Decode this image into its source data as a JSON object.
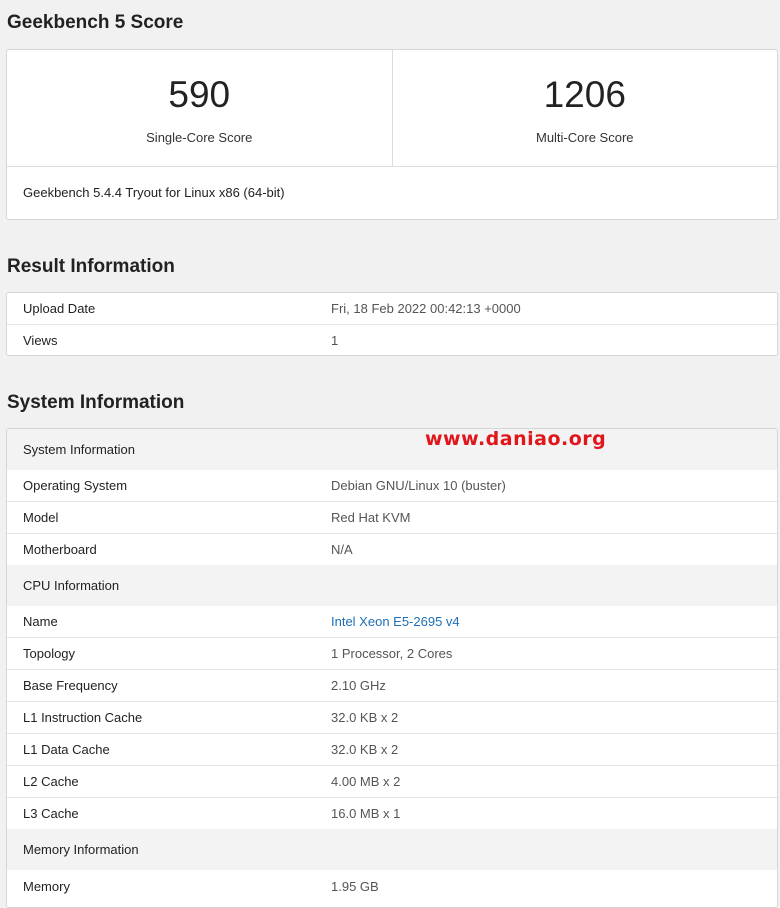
{
  "score_section": {
    "title": "Geekbench 5 Score",
    "single_core": {
      "value": "590",
      "label": "Single-Core Score"
    },
    "multi_core": {
      "value": "1206",
      "label": "Multi-Core Score"
    },
    "version": "Geekbench 5.4.4 Tryout for Linux x86 (64-bit)"
  },
  "result_section": {
    "title": "Result Information",
    "rows": [
      {
        "key": "Upload Date",
        "value": "Fri, 18 Feb 2022 00:42:13 +0000"
      },
      {
        "key": "Views",
        "value": "1"
      }
    ]
  },
  "system_section": {
    "title": "System Information",
    "groups": [
      {
        "header": "System Information",
        "rows": [
          {
            "key": "Operating System",
            "value": "Debian GNU/Linux 10 (buster)"
          },
          {
            "key": "Model",
            "value": "Red Hat KVM"
          },
          {
            "key": "Motherboard",
            "value": "N/A"
          }
        ]
      },
      {
        "header": "CPU Information",
        "rows": [
          {
            "key": "Name",
            "value": "Intel Xeon E5-2695 v4"
          },
          {
            "key": "Topology",
            "value": "1 Processor, 2 Cores"
          },
          {
            "key": "Base Frequency",
            "value": "2.10 GHz"
          },
          {
            "key": "L1 Instruction Cache",
            "value": "32.0 KB x 2"
          },
          {
            "key": "L1 Data Cache",
            "value": "32.0 KB x 2"
          },
          {
            "key": "L2 Cache",
            "value": "4.00 MB x 2"
          },
          {
            "key": "L3 Cache",
            "value": "16.0 MB x 1"
          }
        ]
      },
      {
        "header": "Memory Information",
        "rows": [
          {
            "key": "Memory",
            "value": "1.95 GB"
          }
        ]
      }
    ]
  },
  "watermark": "www.daniao.org",
  "colors": {
    "link": "#1e6fb5",
    "watermark": "#e0161c"
  }
}
